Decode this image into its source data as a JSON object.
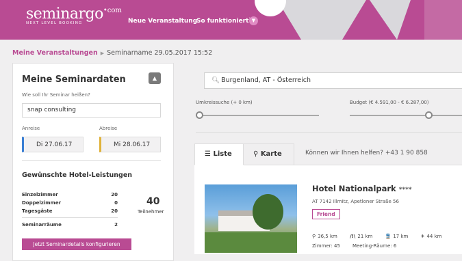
{
  "header": {
    "logo_word": "seminargo",
    "logo_sup": "•com",
    "logo_tagline": "NEXT LEVEL BOOKING",
    "nav": [
      "Neue Veranstaltung",
      "So funktioniert`s"
    ],
    "brand_color": "#b94b93"
  },
  "breadcrumb": {
    "root": "Meine Veranstaltungen",
    "current": "Seminarname 29.05.2017 15:52"
  },
  "sidebar": {
    "title": "Meine Seminardaten",
    "name_label": "Wie soll Ihr Seminar heißen?",
    "name_value": "snap consulting",
    "arrival_label": "Anreise",
    "departure_label": "Abreise",
    "arrival_date": "Di 27.06.17",
    "departure_date": "Mi 28.06.17",
    "services_title": "Gewünschte Hotel-Leistungen",
    "services": [
      {
        "label": "Einzelzimmer",
        "value": "20"
      },
      {
        "label": "Doppelzimmer",
        "value": "0"
      },
      {
        "label": "Tagesgäste",
        "value": "20"
      },
      {
        "label": "Seminarräume",
        "value": "2"
      }
    ],
    "participants_count": "40",
    "participants_label": "Teilnehmer",
    "configure_button": "Jetzt Seminardetails konfigurieren"
  },
  "search": {
    "value": "Burgenland, AT - Österreich",
    "radius_label": "Umkreissuche (+ 0 km)",
    "budget_label": "Budget (€ 4.591,00 - € 6.287,00)"
  },
  "tabs": [
    {
      "label": "Liste",
      "icon": "list-icon"
    },
    {
      "label": "Karte",
      "icon": "map-pin-icon"
    }
  ],
  "help_text": "Können wir Ihnen helfen? +43 1 90 858",
  "hotel": {
    "name": "Hotel Nationalpark",
    "stars": "****",
    "address": "AT 7142 Illmitz, Apetloner Straße 56",
    "badge": "Friend",
    "distances": [
      {
        "icon": "location-icon",
        "glyph": "⚲",
        "value": "36,5 km"
      },
      {
        "icon": "road-icon",
        "glyph": "/!\\",
        "value": "21 km"
      },
      {
        "icon": "train-icon",
        "glyph": "🚆",
        "value": "17 km"
      },
      {
        "icon": "plane-icon",
        "glyph": "✈",
        "value": "44 km"
      }
    ],
    "rooms": "Zimmer: 45",
    "meeting_rooms": "Meeting-Räume: 6"
  }
}
